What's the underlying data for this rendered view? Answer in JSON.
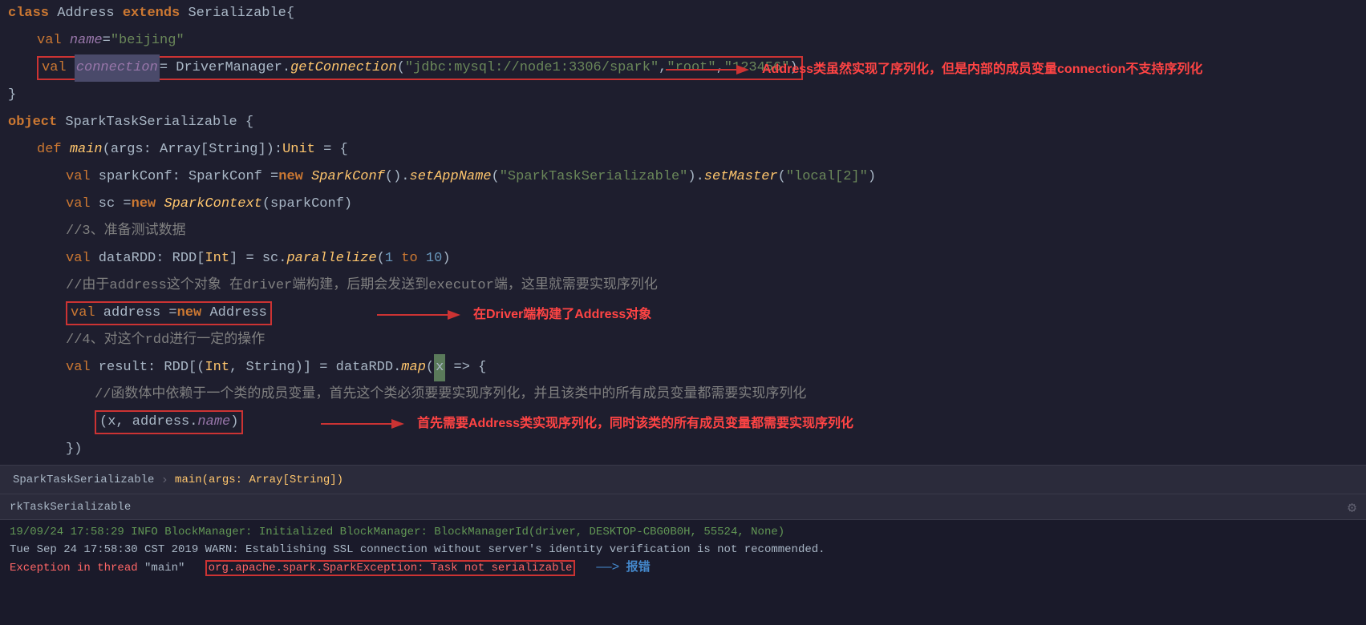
{
  "code": {
    "lines": [
      {
        "id": "line1",
        "content": "class_Address_extends_Serializable"
      },
      {
        "id": "line2",
        "content": "val_name"
      },
      {
        "id": "line3",
        "content": "val_connection_highlighted"
      },
      {
        "id": "line4",
        "content": "closing_brace"
      },
      {
        "id": "line5",
        "content": "object_SparkTaskSerializable"
      },
      {
        "id": "line6",
        "content": "def_main"
      },
      {
        "id": "line7",
        "content": "val_sparkConf"
      },
      {
        "id": "line8",
        "content": "val_sc"
      },
      {
        "id": "line9",
        "content": "comment_prepare"
      },
      {
        "id": "line10",
        "content": "val_dataRDD"
      },
      {
        "id": "line11",
        "content": "comment_address"
      },
      {
        "id": "line12",
        "content": "val_address_new"
      },
      {
        "id": "line13",
        "content": "comment_operation"
      },
      {
        "id": "line14",
        "content": "val_result"
      },
      {
        "id": "line15",
        "content": "comment_func"
      },
      {
        "id": "line16",
        "content": "x_address_name"
      }
    ],
    "annotations": {
      "connection_note": "Address类虽然实现了序列化，但是内部的成员变量connection不支持序列化",
      "address_note": "在Driver端构建了Address对象",
      "serializable_note": "首先需要Address类实现序列化，同时该类的所有成员变量都需要实现序列化"
    }
  },
  "breadcrumb": {
    "class_name": "SparkTaskSerializable",
    "separator": ">",
    "method_name": "main(args: Array[String])"
  },
  "bottom_panel": {
    "title": "rkTaskSerializable",
    "gear_icon": "⚙",
    "console_lines": [
      "19/09/24 17:58:29 INFO BlockManager: Initialized BlockManager: BlockManagerId(driver, DESKTOP-CBG0B0H, 55524, None)",
      "Tue Sep 24 17:58:30 CST 2019 WARN: Establishing SSL connection without server's identity verification is not recommended.",
      "Exception in thread \"main\" org.apache.spark.SparkException: Task not serializable"
    ],
    "error_label": "报错"
  }
}
